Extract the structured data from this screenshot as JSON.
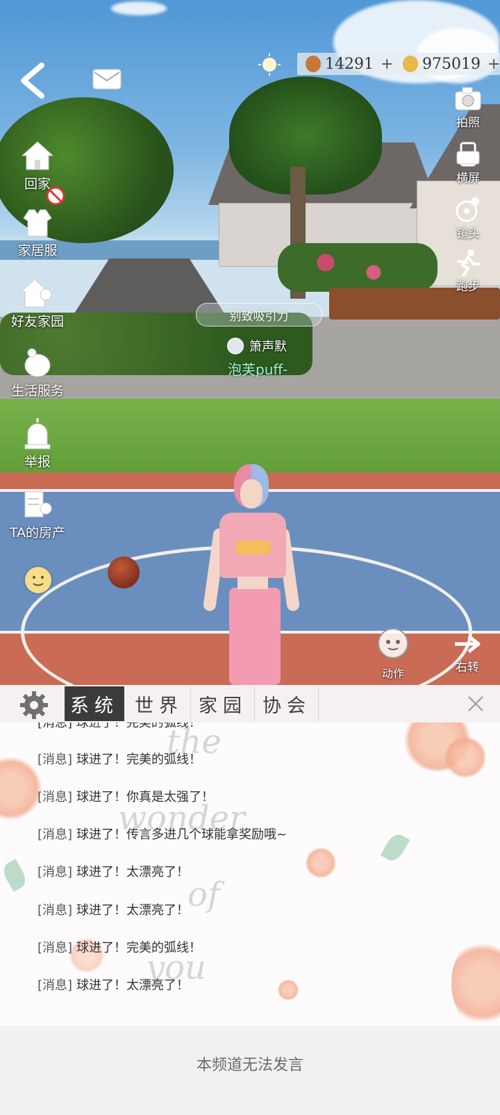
{
  "hud": {
    "currency": [
      {
        "icon": "acorn-coin-icon",
        "value": "14291",
        "color": "#c8773a"
      },
      {
        "icon": "gold-coin-icon",
        "value": "975019",
        "color": "#e7b84a"
      }
    ],
    "left_menu": [
      {
        "label": "回家",
        "icon": "home-icon"
      },
      {
        "label": "家居服",
        "icon": "homewear-icon"
      },
      {
        "label": "好友家园",
        "icon": "friend-home-icon"
      },
      {
        "label": "生活服务",
        "icon": "life-service-icon"
      },
      {
        "label": "举报",
        "icon": "report-alarm-icon"
      },
      {
        "label": "TA的房产",
        "icon": "property-icon"
      }
    ],
    "right_menu": [
      {
        "label": "拍照",
        "icon": "camera-icon"
      },
      {
        "label": "横屏",
        "icon": "rotate-screen-icon"
      },
      {
        "label": "镜头",
        "icon": "lens-icon"
      },
      {
        "label": "跑步",
        "icon": "running-icon"
      }
    ],
    "action_label": "动作",
    "turn_label": "右转",
    "player_title": "别致吸引力",
    "player_guild": "箫声默",
    "player_name": "泡芙puff-"
  },
  "chat": {
    "tabs": [
      {
        "label": "系统",
        "active": true
      },
      {
        "label": "世界",
        "active": false
      },
      {
        "label": "家园",
        "active": false
      },
      {
        "label": "协会",
        "active": false
      }
    ],
    "messages": [
      {
        "tag": "[消息]",
        "text": "球进了！完美的弧线！"
      },
      {
        "tag": "[消息]",
        "text": "球进了！你真是太强了！"
      },
      {
        "tag": "[消息]",
        "text": "球进了！传言多进几个球能拿奖励哦~"
      },
      {
        "tag": "[消息]",
        "text": "球进了！太漂亮了！"
      },
      {
        "tag": "[消息]",
        "text": "球进了！太漂亮了！"
      },
      {
        "tag": "[消息]",
        "text": "球进了！完美的弧线！"
      },
      {
        "tag": "[消息]",
        "text": "球进了！太漂亮了！"
      }
    ],
    "partial_top_message": "[消息] 球进了！完美的弧线！",
    "watermark": [
      "the",
      "wonder",
      "of",
      "you"
    ],
    "input_notice": "本频道无法发言"
  }
}
